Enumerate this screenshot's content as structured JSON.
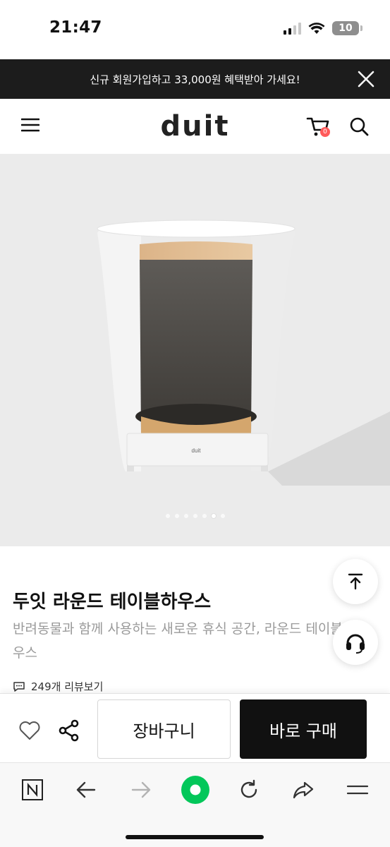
{
  "status_bar": {
    "time": "21:47",
    "battery": "10"
  },
  "promo_banner": {
    "text": "신규 회원가입하고 33,000원 혜택받아 가세요!"
  },
  "header": {
    "logo": "duit",
    "cart_count": "0"
  },
  "product_image": {
    "brand_mark": "duit",
    "slide_count": 7,
    "active_slide": 6
  },
  "product": {
    "title": "두잇 라운드 테이블하우스",
    "subtitle": "반려동물과 함께 사용하는 새로운 휴식 공간, 라운드 테이블하우스",
    "review_link": "249개 리뷰보기"
  },
  "actions": {
    "cart_label": "장바구니",
    "buy_label": "바로 구매"
  },
  "colors": {
    "banner_bg": "#1c1c1c",
    "buy_bg": "#111111",
    "accent_green": "#03c75a",
    "cart_badge": "#ff5a5a"
  }
}
